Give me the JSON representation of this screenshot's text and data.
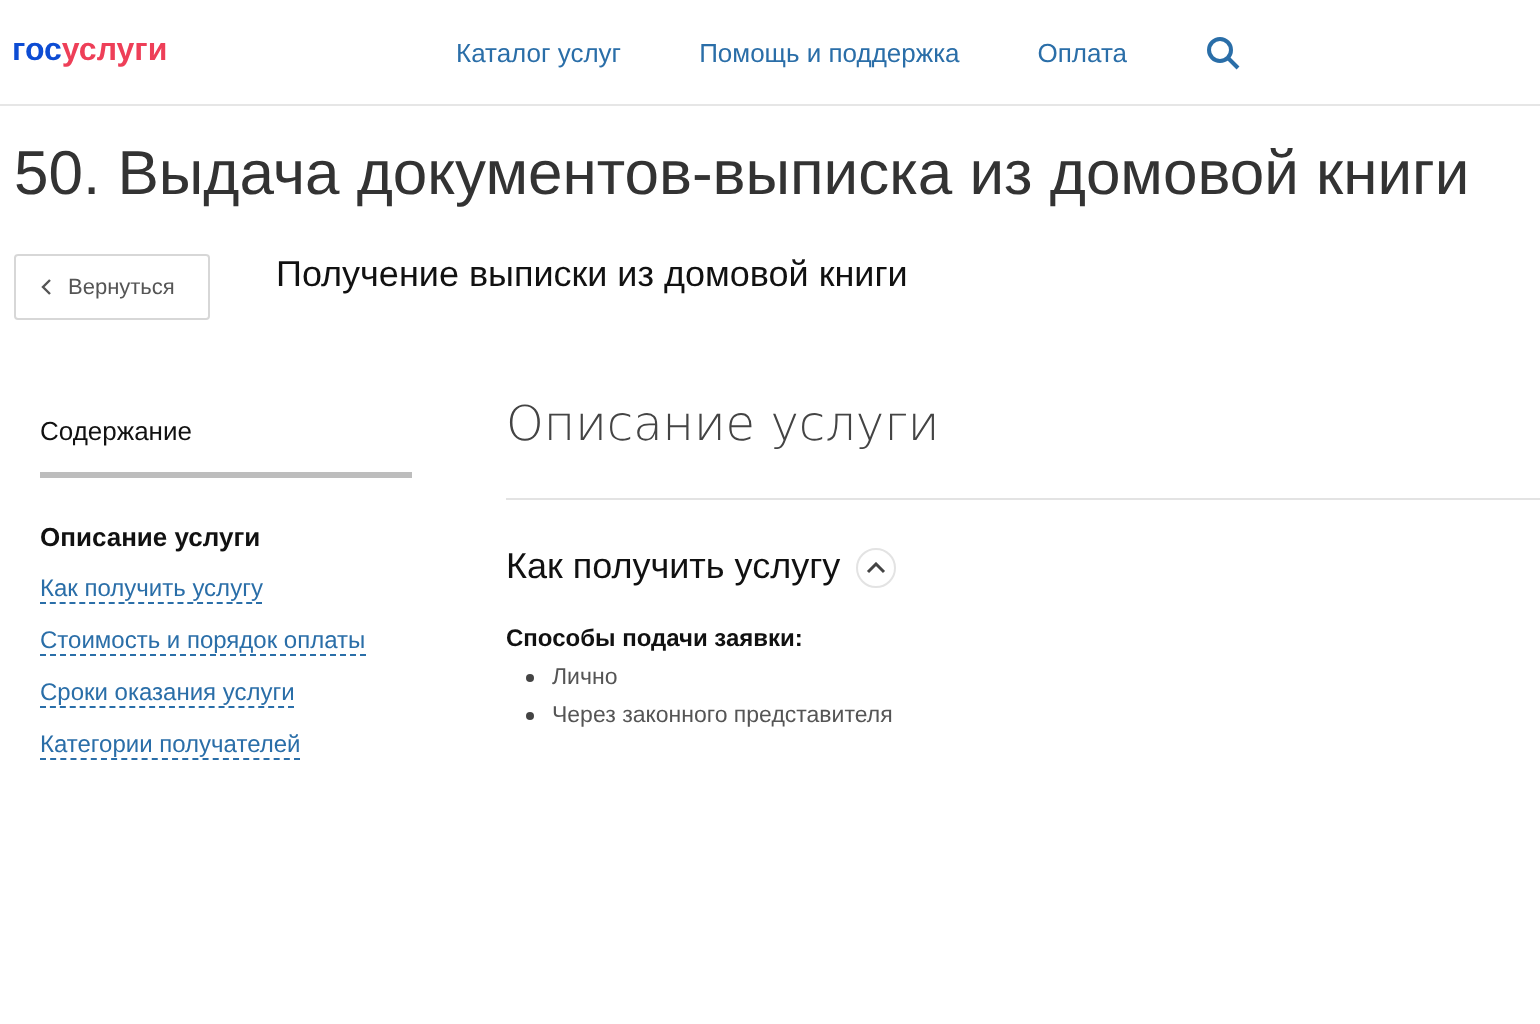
{
  "header": {
    "logo": {
      "part_1": "гос",
      "part_2": "услуги"
    },
    "nav": [
      "Каталог услуг",
      "Помощь и поддержка",
      "Оплата"
    ]
  },
  "page_title": "50. Выдача документов-выписка из домовой книги",
  "back_button": "Вернуться",
  "subtitle": "Получение выписки из домовой книги",
  "sidebar": {
    "title": "Содержание",
    "items": [
      {
        "label": "Описание услуги",
        "selected": true
      },
      {
        "label": "Как получить услугу",
        "selected": false
      },
      {
        "label": "Стоимость и порядок оплаты",
        "selected": false
      },
      {
        "label": "Сроки оказания услуги",
        "selected": false
      },
      {
        "label": "Категории получателей",
        "selected": false
      }
    ]
  },
  "content": {
    "heading": "Описание услуги",
    "section": {
      "title": "Как получить услугу",
      "expanded": true,
      "label": "Способы подачи заявки:",
      "items": [
        "Лично",
        "Через законного представителя"
      ]
    }
  }
}
